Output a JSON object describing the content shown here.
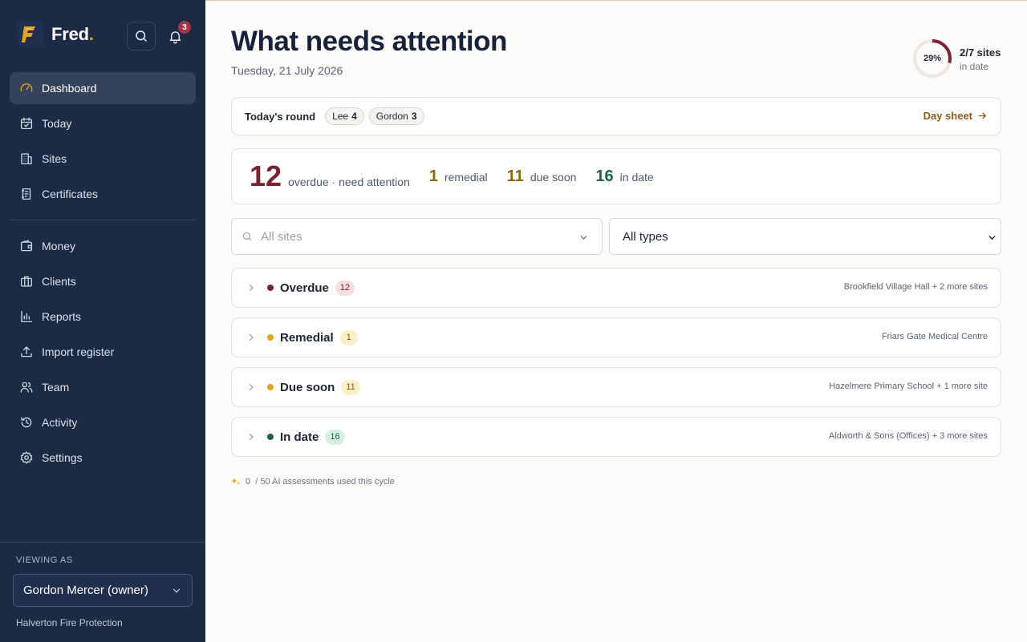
{
  "brand": {
    "name": "Fred",
    "dot": "."
  },
  "notifications": {
    "count": "3"
  },
  "nav": {
    "items": [
      {
        "label": "Dashboard",
        "icon": "gauge-icon"
      },
      {
        "label": "Today",
        "icon": "calendar-check-icon"
      },
      {
        "label": "Sites",
        "icon": "building-icon"
      },
      {
        "label": "Certificates",
        "icon": "certificate-icon"
      },
      {
        "label": "Money",
        "icon": "wallet-icon"
      },
      {
        "label": "Clients",
        "icon": "briefcase-icon"
      },
      {
        "label": "Reports",
        "icon": "bar-chart-icon"
      },
      {
        "label": "Import register",
        "icon": "upload-icon"
      },
      {
        "label": "Team",
        "icon": "users-icon"
      },
      {
        "label": "Activity",
        "icon": "history-icon"
      },
      {
        "label": "Settings",
        "icon": "gear-icon"
      }
    ]
  },
  "viewing": {
    "label": "VIEWING AS",
    "user": "Gordon Mercer (owner)",
    "company": "Halverton Fire Protection"
  },
  "header": {
    "title": "What needs attention",
    "date": "Tuesday, 21 July 2026"
  },
  "compliance": {
    "percent_label": "29%",
    "percent_value": 0.29,
    "sites": "2/7 sites",
    "sub": "in date"
  },
  "round": {
    "label": "Today's round",
    "chips": [
      {
        "name": "Lee",
        "count": "4"
      },
      {
        "name": "Gordon",
        "count": "3"
      }
    ],
    "day_sheet": "Day sheet"
  },
  "stats": {
    "overdue": {
      "num": "12",
      "label": "overdue · need attention"
    },
    "remedial": {
      "num": "1",
      "label": "remedial"
    },
    "due_soon": {
      "num": "11",
      "label": "due soon"
    },
    "in_date": {
      "num": "16",
      "label": "in date"
    }
  },
  "filters": {
    "sites_placeholder": "All sites",
    "types_value": "All types"
  },
  "groups": [
    {
      "title": "Overdue",
      "count": "12",
      "sites": "Brookfield Village Hall + 2 more sites",
      "color": "#7a2433",
      "badge_bg": "#f6dde0",
      "badge_fg": "#7a2433"
    },
    {
      "title": "Remedial",
      "count": "1",
      "sites": "Friars Gate Medical Centre",
      "color": "#e3a51c",
      "badge_bg": "#fbefc9",
      "badge_fg": "#7a5a0c"
    },
    {
      "title": "Due soon",
      "count": "11",
      "sites": "Hazelmere Primary School + 1 more site",
      "color": "#e3a51c",
      "badge_bg": "#fbefc9",
      "badge_fg": "#7a5a0c"
    },
    {
      "title": "In date",
      "count": "16",
      "sites": "Aldworth & Sons (Offices) + 3 more sites",
      "color": "#1f6244",
      "badge_bg": "#d9efe2",
      "badge_fg": "#1f6244"
    }
  ],
  "ai_usage": {
    "used": "0",
    "text": "/ 50 AI assessments used this cycle"
  }
}
